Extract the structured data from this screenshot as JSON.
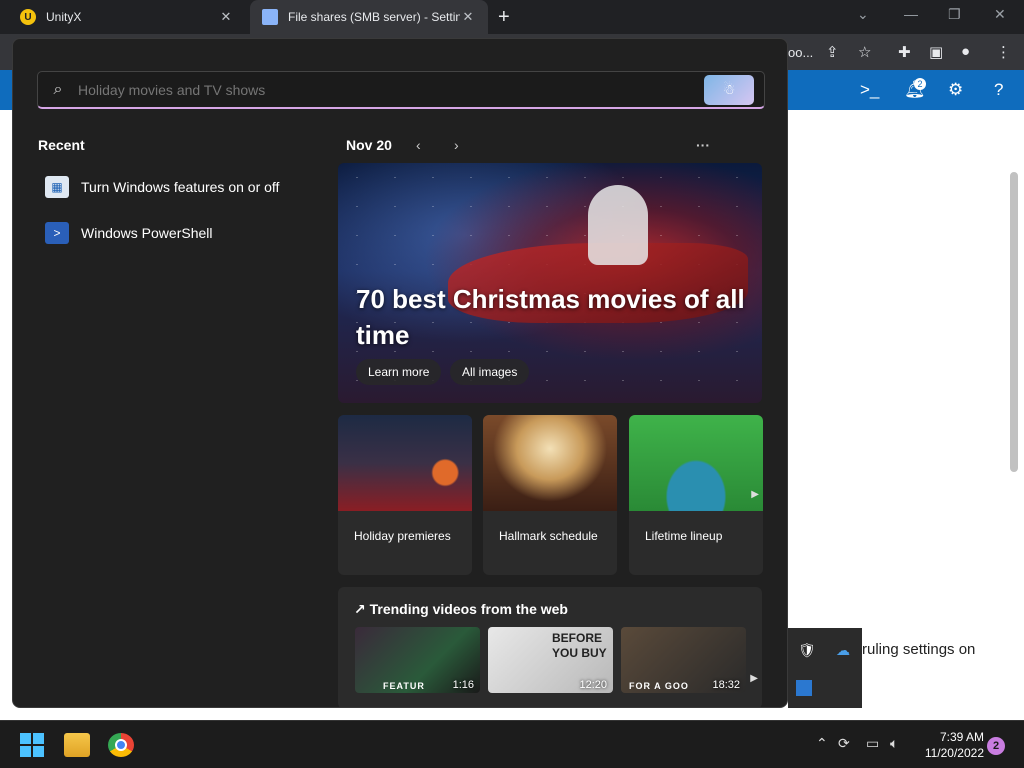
{
  "browser": {
    "tabs": [
      {
        "title": "UnityX",
        "close": "✕",
        "favicon": "U"
      },
      {
        "title": "File shares (SMB server) - Setting",
        "close": "✕"
      }
    ],
    "new_tab": "+",
    "omnibox_tail": "oo..."
  },
  "page": {
    "header_badge": "2",
    "partial_text": "ruling settings on"
  },
  "search": {
    "placeholder": "Holiday movies and TV shows",
    "value": ""
  },
  "recent": {
    "heading": "Recent",
    "items": [
      {
        "label": "Turn Windows features on or off"
      },
      {
        "label": "Windows PowerShell"
      }
    ]
  },
  "feed": {
    "date": "Nov 20",
    "prev": "‹",
    "next": "›",
    "more": "···",
    "hero": {
      "title": "70 best Christmas movies of all time",
      "learn_more": "Learn more",
      "all_images": "All images"
    },
    "cards": [
      {
        "label": "Holiday premieres"
      },
      {
        "label": "Hallmark schedule"
      },
      {
        "label": "Lifetime lineup"
      }
    ],
    "trending": {
      "heading": "↗ Trending videos from the web",
      "videos": [
        {
          "duration": "1:16",
          "bottom_text": "FEATUR"
        },
        {
          "duration": "12:20",
          "overlay": "BEFORE YOU BUY"
        },
        {
          "duration": "18:32",
          "bottom_text": "FOR A GOO"
        }
      ]
    }
  },
  "taskbar": {
    "time": "7:39 AM",
    "date": "11/20/2022",
    "notification_count": "2"
  },
  "colors": {
    "accent_blue": "#0f6cbd",
    "panel_bg": "#202020",
    "search_underline": "#d6a6e6"
  }
}
